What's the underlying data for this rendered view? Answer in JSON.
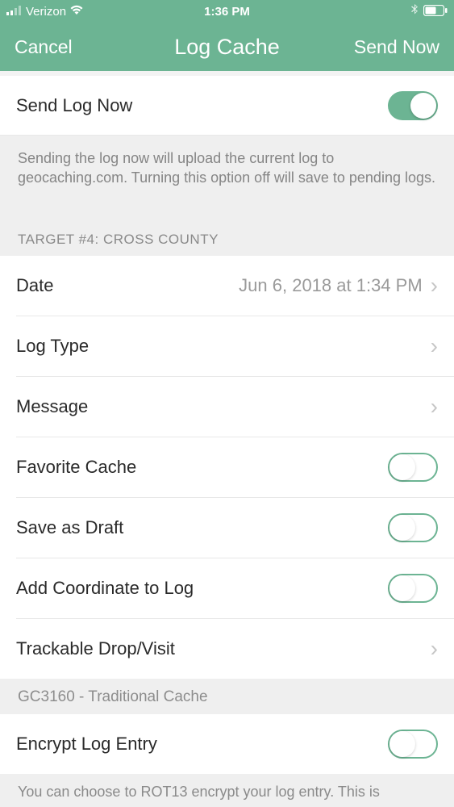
{
  "statusBar": {
    "carrier": "Verizon",
    "time": "1:36 PM"
  },
  "nav": {
    "left": "Cancel",
    "title": "Log Cache",
    "right": "Send Now"
  },
  "rows": {
    "sendLogNow": "Send Log Now",
    "date": {
      "label": "Date",
      "value": "Jun 6, 2018 at 1:34 PM"
    },
    "logType": "Log Type",
    "message": "Message",
    "favoriteCache": "Favorite Cache",
    "saveDraft": "Save as Draft",
    "addCoord": "Add Coordinate to Log",
    "trackable": "Trackable Drop/Visit",
    "encrypt": "Encrypt Log Entry"
  },
  "sections": {
    "sendDesc": "Sending the log now will upload the current log to geocaching.com. Turning this option off will save to pending logs.",
    "target": "TARGET #4: CROSS COUNTY",
    "cacheInfo": "GC3160 - Traditional Cache",
    "encryptDesc": "You can choose to ROT13 encrypt your log entry. This is"
  }
}
